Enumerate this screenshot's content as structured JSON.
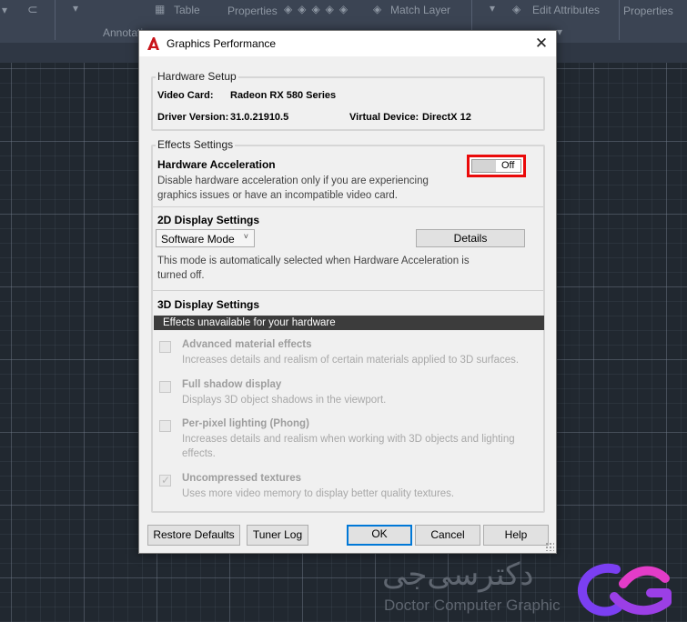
{
  "ribbon": {
    "items": [
      "Annotati",
      "Table",
      "Properties",
      "Match Layer",
      "Edit Attributes",
      "Properties"
    ]
  },
  "watermark": {
    "persian": "دکترسی‌جی",
    "english": "Doctor Computer Graphic"
  },
  "dialog": {
    "title": "Graphics Performance",
    "close_glyph": "✕",
    "hardware_setup": {
      "group_label": "Hardware Setup",
      "video_card_label": "Video Card:",
      "video_card_value": "Radeon RX 580 Series",
      "driver_label": "Driver Version:",
      "driver_value": "31.0.21910.5",
      "virtual_device_label": "Virtual Device:",
      "virtual_device_value": "DirectX 12"
    },
    "effects": {
      "group_label": "Effects Settings",
      "hw_accel_title": "Hardware Acceleration",
      "hw_accel_desc": "Disable hardware acceleration only if you are experiencing graphics issues or have an incompatible video card.",
      "toggle_label": "Off",
      "display2d_title": "2D Display Settings",
      "mode_selected": "Software Mode",
      "details_button": "Details",
      "mode_desc": "This mode is automatically selected when Hardware Acceleration is turned off.",
      "display3d_title": "3D Display Settings",
      "unavailable_text": "Effects unavailable for your hardware",
      "options": [
        {
          "title": "Advanced material effects",
          "desc": "Increases details and realism of certain materials applied to 3D surfaces.",
          "checked": false
        },
        {
          "title": "Full shadow display",
          "desc": "Displays 3D object shadows in the viewport.",
          "checked": false
        },
        {
          "title": "Per-pixel lighting (Phong)",
          "desc": "Increases details and realism when working with 3D objects and lighting effects.",
          "checked": false
        },
        {
          "title": "Uncompressed textures",
          "desc": "Uses more video memory to display better quality textures.",
          "checked": true
        }
      ]
    },
    "buttons": {
      "restore_defaults": "Restore Defaults",
      "tuner_log": "Tuner Log",
      "ok": "OK",
      "cancel": "Cancel",
      "help": "Help"
    }
  },
  "colors": {
    "highlight": "#ea0a0a",
    "canvas_bg": "#212830",
    "ribbon_bg": "#3b4453",
    "accent_blue": "#0078d7",
    "logo_purple": "#7b3ff2",
    "logo_pink": "#e33cc8"
  }
}
